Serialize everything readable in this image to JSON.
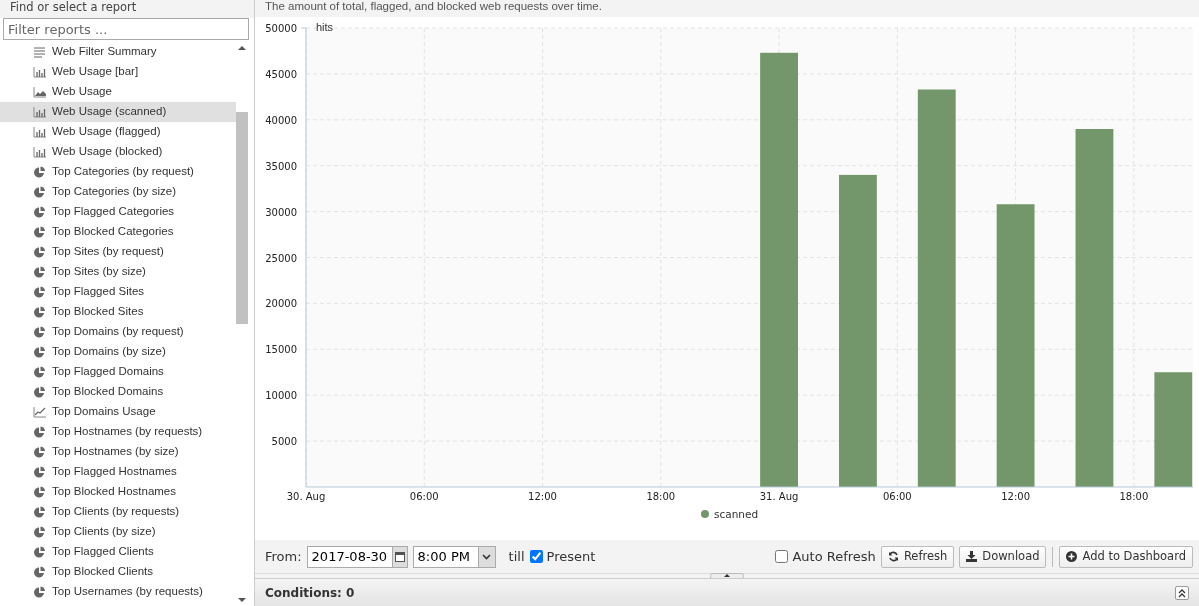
{
  "sidebar": {
    "title": "Find or select a report",
    "filter": {
      "placeholder": "Filter reports ..."
    },
    "items": [
      {
        "label": "Web Filter Summary",
        "kind": "list",
        "selected": false
      },
      {
        "label": "Web Usage [bar]",
        "kind": "bar",
        "selected": false
      },
      {
        "label": "Web Usage",
        "kind": "area",
        "selected": false
      },
      {
        "label": "Web Usage (scanned)",
        "kind": "bar",
        "selected": true
      },
      {
        "label": "Web Usage (flagged)",
        "kind": "bar",
        "selected": false
      },
      {
        "label": "Web Usage (blocked)",
        "kind": "bar",
        "selected": false
      },
      {
        "label": "Top Categories (by request)",
        "kind": "pie",
        "selected": false
      },
      {
        "label": "Top Categories (by size)",
        "kind": "pie",
        "selected": false
      },
      {
        "label": "Top Flagged Categories",
        "kind": "pie",
        "selected": false
      },
      {
        "label": "Top Blocked Categories",
        "kind": "pie",
        "selected": false
      },
      {
        "label": "Top Sites (by request)",
        "kind": "pie",
        "selected": false
      },
      {
        "label": "Top Sites (by size)",
        "kind": "pie",
        "selected": false
      },
      {
        "label": "Top Flagged Sites",
        "kind": "pie",
        "selected": false
      },
      {
        "label": "Top Blocked Sites",
        "kind": "pie",
        "selected": false
      },
      {
        "label": "Top Domains (by request)",
        "kind": "pie",
        "selected": false
      },
      {
        "label": "Top Domains (by size)",
        "kind": "pie",
        "selected": false
      },
      {
        "label": "Top Flagged Domains",
        "kind": "pie",
        "selected": false
      },
      {
        "label": "Top Blocked Domains",
        "kind": "pie",
        "selected": false
      },
      {
        "label": "Top Domains Usage",
        "kind": "line",
        "selected": false
      },
      {
        "label": "Top Hostnames (by requests)",
        "kind": "pie",
        "selected": false
      },
      {
        "label": "Top Hostnames (by size)",
        "kind": "pie",
        "selected": false
      },
      {
        "label": "Top Flagged Hostnames",
        "kind": "pie",
        "selected": false
      },
      {
        "label": "Top Blocked Hostnames",
        "kind": "pie",
        "selected": false
      },
      {
        "label": "Top Clients (by requests)",
        "kind": "pie",
        "selected": false
      },
      {
        "label": "Top Clients (by size)",
        "kind": "pie",
        "selected": false
      },
      {
        "label": "Top Flagged Clients",
        "kind": "pie",
        "selected": false
      },
      {
        "label": "Top Blocked Clients",
        "kind": "pie",
        "selected": false
      },
      {
        "label": "Top Usernames (by requests)",
        "kind": "pie",
        "selected": false
      }
    ]
  },
  "report": {
    "description": "The amount of total, flagged, and blocked web requests over time.",
    "chart_data": {
      "type": "bar",
      "ylabel": "hits",
      "grid": true,
      "x": [
        "2017-08-31T00:00",
        "2017-08-31T04:00",
        "2017-08-31T08:00",
        "2017-08-31T12:00",
        "2017-08-31T16:00",
        "2017-08-31T20:00"
      ],
      "series": [
        {
          "name": "scanned",
          "color": "#73976a",
          "values": [
            47300,
            34000,
            43300,
            30800,
            39000,
            12500
          ]
        }
      ],
      "xlim": [
        "2017-08-30T00:00",
        "2017-08-31T21:00"
      ],
      "ylim": [
        0,
        50000
      ],
      "xticks": [
        {
          "value": "2017-08-30T00:00",
          "label": "30. Aug"
        },
        {
          "value": "2017-08-30T06:00",
          "label": "06:00"
        },
        {
          "value": "2017-08-30T12:00",
          "label": "12:00"
        },
        {
          "value": "2017-08-30T18:00",
          "label": "18:00"
        },
        {
          "value": "2017-08-31T00:00",
          "label": "31. Aug"
        },
        {
          "value": "2017-08-31T06:00",
          "label": "06:00"
        },
        {
          "value": "2017-08-31T12:00",
          "label": "12:00"
        },
        {
          "value": "2017-08-31T18:00",
          "label": "18:00"
        }
      ],
      "yticks": [
        5000,
        10000,
        15000,
        20000,
        25000,
        30000,
        35000,
        40000,
        45000,
        50000
      ]
    }
  },
  "toolbar": {
    "from_label": "From:",
    "date": "2017-08-30",
    "time": "8:00 PM",
    "till_label": "till",
    "present": {
      "label": "Present",
      "checked": true
    },
    "auto_refresh": {
      "label": "Auto Refresh",
      "checked": false
    },
    "buttons": [
      {
        "label": "Refresh",
        "kind": "refresh"
      },
      {
        "label": "Download",
        "kind": "download"
      },
      {
        "label": "Add to Dashboard",
        "kind": "add"
      }
    ]
  },
  "conditions": {
    "title": "Conditions: 0"
  }
}
